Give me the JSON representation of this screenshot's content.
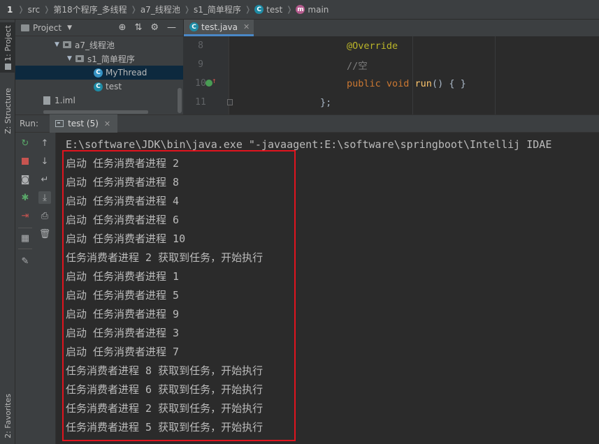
{
  "breadcrumb": {
    "num": "1",
    "items": [
      "src",
      "第18个程序_多线程",
      "a7_线程池",
      "s1_简单程序",
      "test",
      "main"
    ]
  },
  "left_strip": {
    "project_tab": "1: Project",
    "structure_tab": "Z: Structure",
    "favorites_tab": "2: Favorites"
  },
  "project_panel": {
    "title": "Project",
    "tree": [
      {
        "label": "a7_线程池"
      },
      {
        "label": "s1_简单程序"
      },
      {
        "label": "MyThread"
      },
      {
        "label": "test"
      },
      {
        "label": "1.iml"
      }
    ]
  },
  "editor": {
    "tab_label": "test.java",
    "lines": [
      {
        "num": "8",
        "text": "@Override"
      },
      {
        "num": "9",
        "text": "//空"
      },
      {
        "num": "10",
        "kw": "public void ",
        "fn": "run",
        "rest": "() { }"
      },
      {
        "num": "11",
        "text": "};"
      }
    ]
  },
  "run": {
    "label": "Run:",
    "tab_label": "test (5)",
    "console": [
      "E:\\software\\JDK\\bin\\java.exe \"-javaagent:E:\\software\\springboot\\Intellij IDAE",
      "启动 任务消费者进程 2",
      "启动 任务消费者进程 8",
      "启动 任务消费者进程 4",
      "启动 任务消费者进程 6",
      "启动 任务消费者进程 10",
      "任务消费者进程 2 获取到任务，开始执行",
      "启动 任务消费者进程 1",
      "启动 任务消费者进程 5",
      "启动 任务消费者进程 9",
      "启动 任务消费者进程 3",
      "启动 任务消费者进程 7",
      "任务消费者进程 8 获取到任务，开始执行",
      "任务消费者进程 6 获取到任务，开始执行",
      "任务消费者进程 2 获取到任务，开始执行",
      "任务消费者进程 5 获取到任务，开始执行"
    ]
  },
  "colors": {
    "highlight": "#e0141e",
    "selected_row": "#0d293e",
    "annotation": "#bbb529",
    "keyword": "#cc7832",
    "function": "#ffc66d"
  }
}
